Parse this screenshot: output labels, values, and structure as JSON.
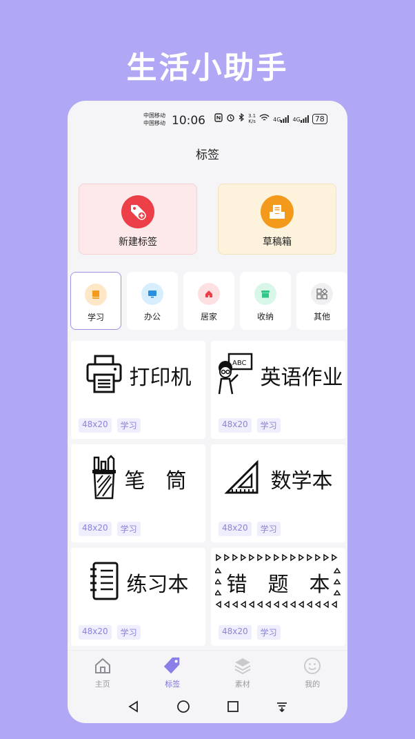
{
  "headline": "生活小助手",
  "status_bar": {
    "carrier_1": "中国移动",
    "carrier_2": "中国移动",
    "time": "10:06",
    "net_speed_value": "3.1",
    "net_speed_unit": "K/s",
    "signal_1": "4G",
    "signal_2": "4G",
    "battery": "78"
  },
  "page_title": "标签",
  "actions": [
    {
      "label": "新建标签",
      "icon": "tag-plus-icon",
      "color": "#ec3f47"
    },
    {
      "label": "草稿箱",
      "icon": "draft-box-icon",
      "color": "#f39a1c"
    }
  ],
  "categories": [
    {
      "label": "学习",
      "icon": "book-icon",
      "selected": true
    },
    {
      "label": "办公",
      "icon": "monitor-icon",
      "selected": false
    },
    {
      "label": "居家",
      "icon": "home-icon",
      "selected": false
    },
    {
      "label": "收纳",
      "icon": "storage-box-icon",
      "selected": false
    },
    {
      "label": "其他",
      "icon": "grid-shapes-icon",
      "selected": false
    }
  ],
  "label_templates": [
    {
      "text": "打印机",
      "icon": "printer-icon",
      "size": "48x20",
      "tag": "学习"
    },
    {
      "text": "英语作业",
      "icon": "teacher-abc-icon",
      "size": "48x20",
      "tag": "学习"
    },
    {
      "text": "笔　筒",
      "icon": "pen-holder-icon",
      "size": "48x20",
      "tag": "学习"
    },
    {
      "text": "数学本",
      "icon": "ruler-triangle-icon",
      "size": "48x20",
      "tag": "学习"
    },
    {
      "text": "练习本",
      "icon": "notebook-icon",
      "size": "48x20",
      "tag": "学习"
    },
    {
      "text": "错　题　本",
      "icon": "triangle-border-icon",
      "size": "48x20",
      "tag": "学习"
    }
  ],
  "tabs": [
    {
      "label": "主页",
      "icon": "home-outline-icon",
      "active": false
    },
    {
      "label": "标签",
      "icon": "tag-icon",
      "active": true
    },
    {
      "label": "素材",
      "icon": "layers-icon",
      "active": false
    },
    {
      "label": "我的",
      "icon": "smile-icon",
      "active": false
    }
  ],
  "colors": {
    "background": "#b0a8f5",
    "accent": "#7b72e0",
    "chip_bg": "#efeefc",
    "chip_text": "#8a84d8"
  }
}
